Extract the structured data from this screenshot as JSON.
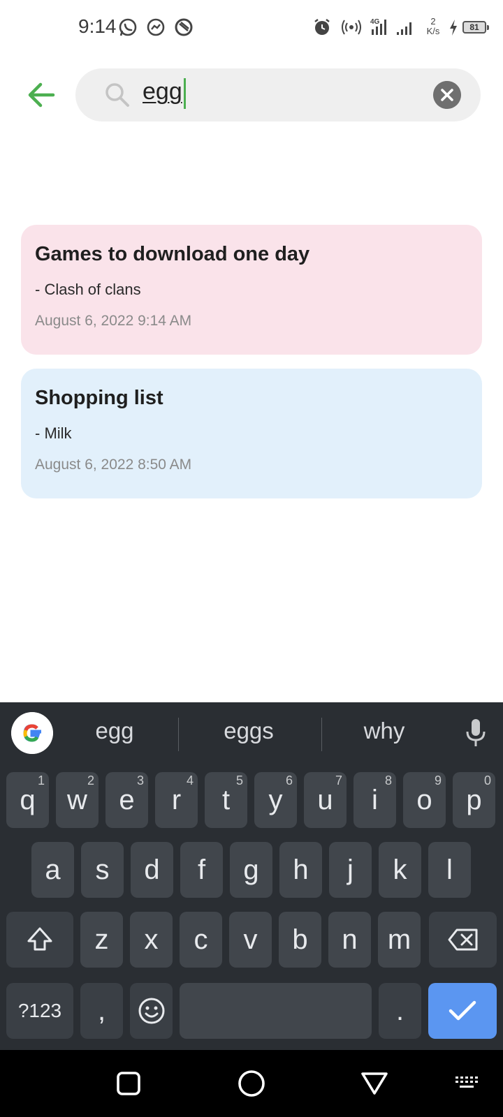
{
  "status_bar": {
    "time": "9:14",
    "icons": [
      "whatsapp-icon",
      "messenger-icon",
      "app-notification-icon",
      "alarm-icon",
      "hotspot-icon",
      "4g-signal-icon",
      "signal-icon",
      "charging-icon"
    ],
    "net_speed_value": "2",
    "net_speed_unit": "K/s",
    "battery": "81"
  },
  "search": {
    "query": "egg",
    "accent_color": "#4caf50"
  },
  "notes": [
    {
      "title": "Games to download one day",
      "body": "- Clash of clans",
      "date": "August 6, 2022 9:14 AM",
      "color": "#fae3ea"
    },
    {
      "title": "Shopping list",
      "body": "- Milk",
      "date": "August 6, 2022 8:50 AM",
      "color": "#e2f0fb"
    }
  ],
  "keyboard": {
    "suggestions": [
      "egg",
      "eggs",
      "why"
    ],
    "row1": [
      {
        "key": "q",
        "hint": "1"
      },
      {
        "key": "w",
        "hint": "2"
      },
      {
        "key": "e",
        "hint": "3"
      },
      {
        "key": "r",
        "hint": "4"
      },
      {
        "key": "t",
        "hint": "5"
      },
      {
        "key": "y",
        "hint": "6"
      },
      {
        "key": "u",
        "hint": "7"
      },
      {
        "key": "i",
        "hint": "8"
      },
      {
        "key": "o",
        "hint": "9"
      },
      {
        "key": "p",
        "hint": "0"
      }
    ],
    "row2": [
      "a",
      "s",
      "d",
      "f",
      "g",
      "h",
      "j",
      "k",
      "l"
    ],
    "row3": [
      "z",
      "x",
      "c",
      "v",
      "b",
      "n",
      "m"
    ],
    "symbols_label": "?123",
    "comma": ",",
    "period": ".",
    "done_color": "#5b96f1"
  },
  "nav": {
    "icons": [
      "recent-apps-icon",
      "home-icon",
      "back-icon",
      "keyboard-switch-icon"
    ]
  }
}
